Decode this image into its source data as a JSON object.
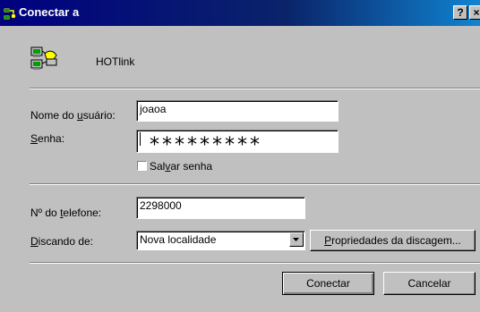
{
  "window": {
    "title": "Conectar a",
    "help_label": "?",
    "close_label": "×"
  },
  "connection": {
    "name": "HOTlink"
  },
  "username": {
    "label_pre": "Nome do ",
    "label_accel": "u",
    "label_post": "suário:",
    "value": "joaoa"
  },
  "password": {
    "label_accel": "S",
    "label_post": "enha:",
    "mask": "*********"
  },
  "save_password": {
    "label_pre": "Sal",
    "label_accel": "v",
    "label_post": "ar senha",
    "checked": false
  },
  "phone": {
    "label_pre": "Nº do ",
    "label_accel": "t",
    "label_post": "elefone:",
    "value": "2298000"
  },
  "dialing_from": {
    "label_accel": "D",
    "label_post": "iscando de:",
    "selected": "Nova localidade"
  },
  "dialing_properties": {
    "label_accel": "P",
    "label_post": "ropriedades da discagem..."
  },
  "buttons": {
    "connect": "Conectar",
    "cancel": "Cancelar"
  },
  "colors": {
    "title_start": "#000080",
    "title_end": "#1084d0",
    "face": "#c0c0c0"
  },
  "icons": {
    "title": "network-computers-icon",
    "connection": "dial-up-networking-icon",
    "dropdown": "dropdown-arrow-icon"
  }
}
